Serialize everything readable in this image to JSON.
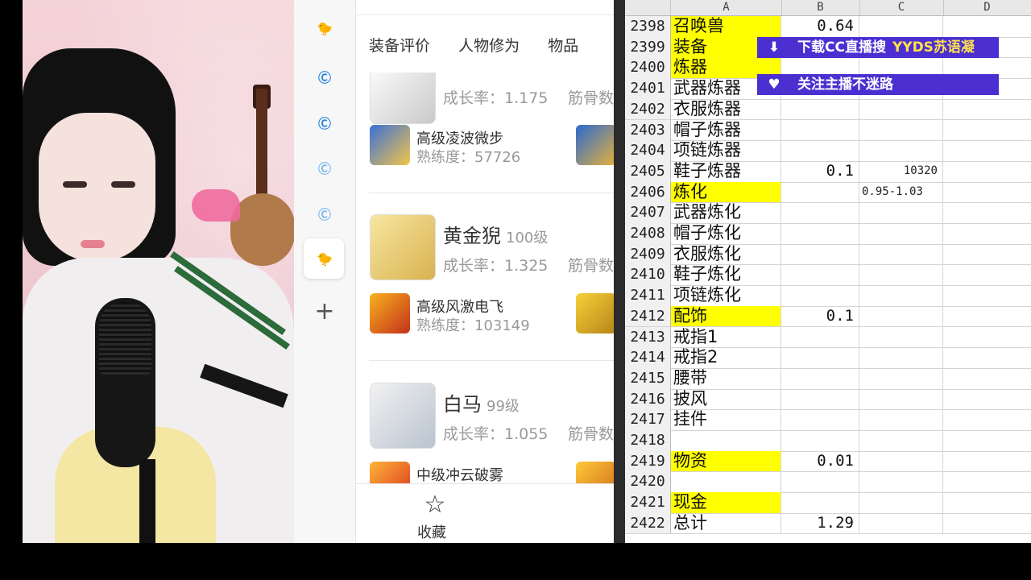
{
  "app": {
    "tabs": [
      "装备评价",
      "人物修为",
      "物品"
    ],
    "pets": [
      {
        "name": "",
        "level": "",
        "growth": "成长率：1.175",
        "bone": "筋骨数",
        "skills": [
          {
            "name": "高级凌波微步",
            "prof": "熟练度：57726"
          }
        ]
      },
      {
        "name": "黄金猊",
        "level": "100级",
        "growth": "成长率：1.325",
        "bone": "筋骨数",
        "skills": [
          {
            "name": "高级风激电飞",
            "prof": "熟练度：103149"
          }
        ]
      },
      {
        "name": "白马",
        "level": "99级",
        "growth": "成长率：1.055",
        "bone": "筋骨数",
        "skills": [
          {
            "name": "中级冲云破雾",
            "prof": ""
          }
        ]
      }
    ],
    "favorite_label": "收藏"
  },
  "sheet": {
    "columns": [
      "A",
      "B",
      "C",
      "D"
    ],
    "rows": [
      {
        "n": "2398",
        "a": "召唤兽",
        "y": true,
        "b": "0.64",
        "c": ""
      },
      {
        "n": "2399",
        "a": "装备",
        "y": true,
        "b": "",
        "c": ""
      },
      {
        "n": "2400",
        "a": "炼器",
        "y": true,
        "b": "",
        "c": ""
      },
      {
        "n": "2401",
        "a": "武器炼器",
        "y": false,
        "b": "",
        "c": ""
      },
      {
        "n": "2402",
        "a": "衣服炼器",
        "y": false,
        "b": "",
        "c": ""
      },
      {
        "n": "2403",
        "a": "帽子炼器",
        "y": false,
        "b": "",
        "c": ""
      },
      {
        "n": "2404",
        "a": "项链炼器",
        "y": false,
        "b": "",
        "c": ""
      },
      {
        "n": "2405",
        "a": "鞋子炼器",
        "y": false,
        "b": "0.1",
        "c": "10320"
      },
      {
        "n": "2406",
        "a": "炼化",
        "y": true,
        "b": "",
        "c": "0.95-1.03"
      },
      {
        "n": "2407",
        "a": "武器炼化",
        "y": false,
        "b": "",
        "c": ""
      },
      {
        "n": "2408",
        "a": "帽子炼化",
        "y": false,
        "b": "",
        "c": ""
      },
      {
        "n": "2409",
        "a": "衣服炼化",
        "y": false,
        "b": "",
        "c": ""
      },
      {
        "n": "2410",
        "a": "鞋子炼化",
        "y": false,
        "b": "",
        "c": ""
      },
      {
        "n": "2411",
        "a": "项链炼化",
        "y": false,
        "b": "",
        "c": ""
      },
      {
        "n": "2412",
        "a": "配饰",
        "y": true,
        "b": "0.1",
        "c": ""
      },
      {
        "n": "2413",
        "a": "戒指1",
        "y": false,
        "b": "",
        "c": ""
      },
      {
        "n": "2414",
        "a": "戒指2",
        "y": false,
        "b": "",
        "c": ""
      },
      {
        "n": "2415",
        "a": "腰带",
        "y": false,
        "b": "",
        "c": ""
      },
      {
        "n": "2416",
        "a": "披风",
        "y": false,
        "b": "",
        "c": ""
      },
      {
        "n": "2417",
        "a": "挂件",
        "y": false,
        "b": "",
        "c": ""
      },
      {
        "n": "2418",
        "a": "",
        "y": false,
        "b": "",
        "c": ""
      },
      {
        "n": "2419",
        "a": "物资",
        "y": true,
        "b": "0.01",
        "c": ""
      },
      {
        "n": "2420",
        "a": "",
        "y": false,
        "b": "",
        "c": ""
      },
      {
        "n": "2421",
        "a": "现金",
        "y": true,
        "b": "",
        "c": ""
      },
      {
        "n": "2422",
        "a": "总计",
        "y": false,
        "b": "1.29",
        "c": ""
      }
    ]
  },
  "overlay": {
    "banner1_text": "下载CC直播搜",
    "banner1_highlight": "YYDS苏语凝",
    "banner2_text": "关注主播不迷路"
  },
  "colors": {
    "yellow_cell": "#ffff00",
    "banner_bg": "#4b2fd1",
    "banner_highlight": "#ffe24a"
  }
}
